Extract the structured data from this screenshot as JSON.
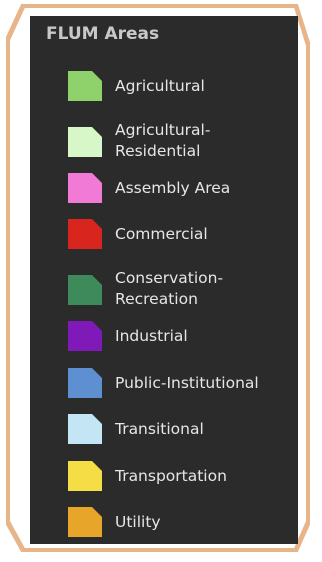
{
  "legend": {
    "title": "FLUM Areas",
    "items": [
      {
        "name": "agricultural",
        "label_lines": [
          "Agricultural"
        ],
        "color": "#8fd16a"
      },
      {
        "name": "agricultural-residential",
        "label_lines": [
          "Agricultural-",
          "Residential"
        ],
        "color": "#d7f7c8"
      },
      {
        "name": "assembly-area",
        "label_lines": [
          "Assembly Area"
        ],
        "color": "#f27ad7"
      },
      {
        "name": "commercial",
        "label_lines": [
          "Commercial"
        ],
        "color": "#d8261f"
      },
      {
        "name": "conservation-recreation",
        "label_lines": [
          "Conservation-",
          "Recreation"
        ],
        "color": "#3f8a5a"
      },
      {
        "name": "industrial",
        "label_lines": [
          "Industrial"
        ],
        "color": "#7f19b8"
      },
      {
        "name": "public-institutional",
        "label_lines": [
          "Public-Institutional"
        ],
        "color": "#5e8fd1"
      },
      {
        "name": "transitional",
        "label_lines": [
          "Transitional"
        ],
        "color": "#c4e5f4"
      },
      {
        "name": "transportation",
        "label_lines": [
          "Transportation"
        ],
        "color": "#f5dd45"
      },
      {
        "name": "utility",
        "label_lines": [
          "Utility"
        ],
        "color": "#e7a52a"
      }
    ]
  }
}
